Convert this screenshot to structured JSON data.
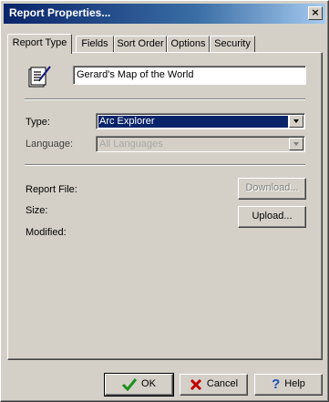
{
  "window": {
    "title": "Report Properties...",
    "close_glyph": "×"
  },
  "tabs": [
    {
      "label": "Report Type",
      "active": true
    },
    {
      "label": "Fields",
      "active": false
    },
    {
      "label": "Sort Order",
      "active": false
    },
    {
      "label": "Options",
      "active": false
    },
    {
      "label": "Security",
      "active": false
    }
  ],
  "report": {
    "icon": "report-document-pen-icon",
    "name_value": "Gerard's Map of the World"
  },
  "type_field": {
    "label": "Type:",
    "selected": "Arc Explorer"
  },
  "language_field": {
    "label": "Language:",
    "selected": "All Languages",
    "enabled": false
  },
  "file_info": {
    "report_file_label": "Report File:",
    "size_label": "Size:",
    "modified_label": "Modified:"
  },
  "file_buttons": {
    "download_label": "Download...",
    "download_enabled": false,
    "upload_label": "Upload..."
  },
  "footer": {
    "ok_label": "OK",
    "cancel_label": "Cancel",
    "help_label": "Help"
  },
  "colors": {
    "title_bar": "#0a246a",
    "dialog_face": "#d4d0c8",
    "selection": "#0a246a",
    "ok_check": "#1f8f1f",
    "cancel_x": "#c00000",
    "help_q": "#1f4fb5"
  }
}
